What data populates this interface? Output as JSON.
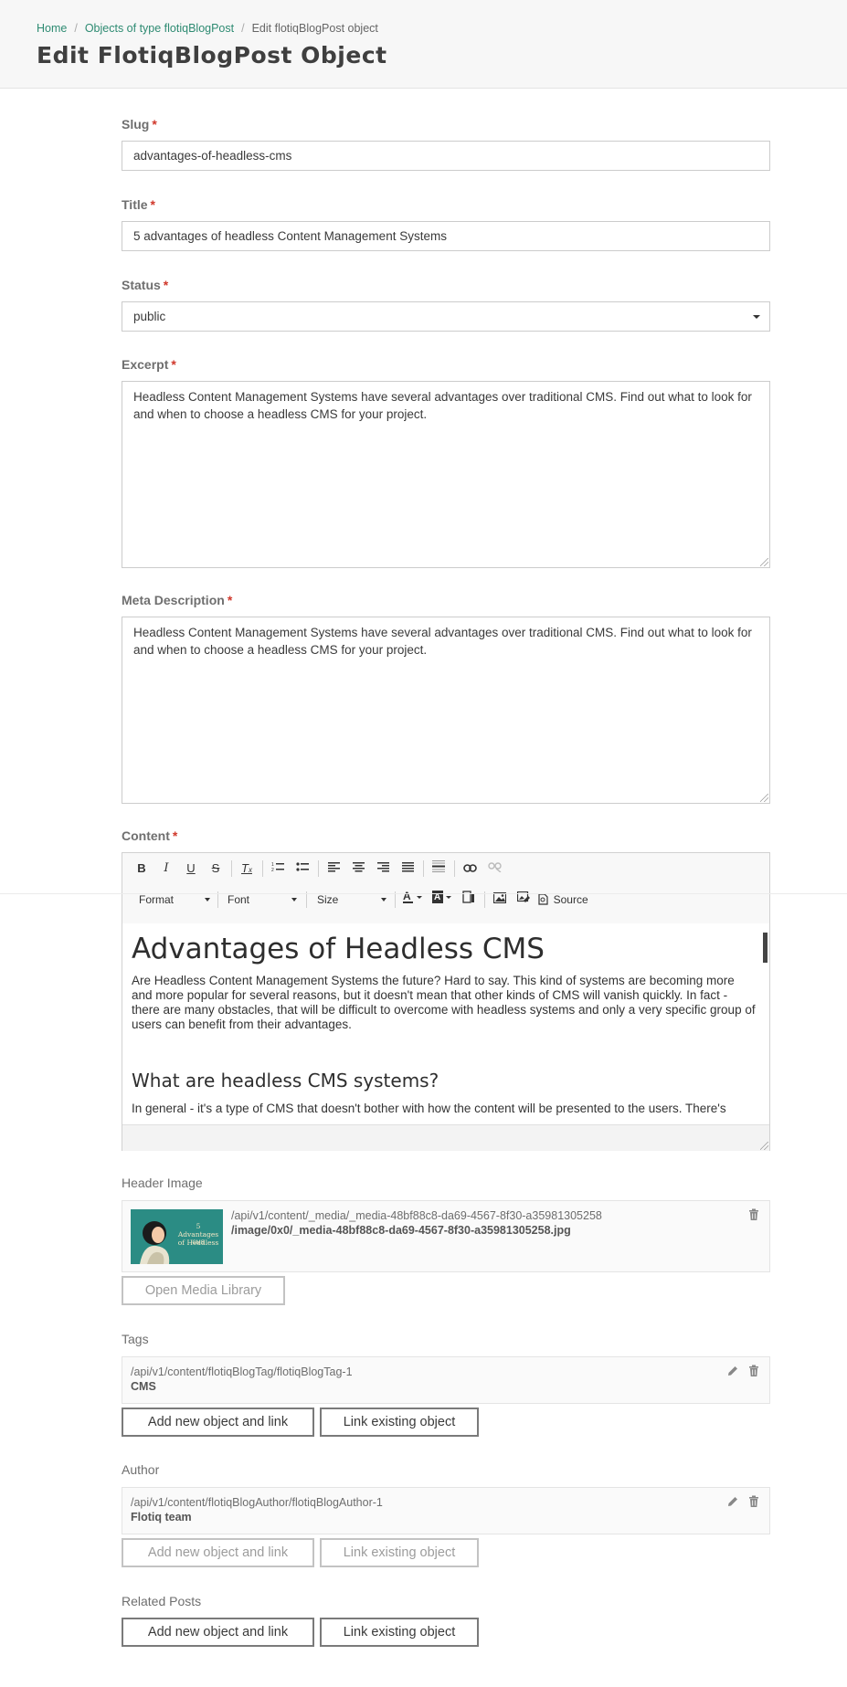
{
  "breadcrumb": {
    "home": "Home",
    "objects": "Objects of type flotiqBlogPost",
    "current": "Edit flotiqBlogPost object",
    "separator": "/"
  },
  "page_title": "Edit FlotiqBlogPost Object",
  "required_marker": "*",
  "fields": {
    "slug": {
      "label": "Slug",
      "value": "advantages-of-headless-cms"
    },
    "title": {
      "label": "Title",
      "value": "5 advantages of headless Content Management Systems"
    },
    "status": {
      "label": "Status",
      "value": "public"
    },
    "excerpt": {
      "label": "Excerpt",
      "value": "Headless Content Management Systems have several advantages over traditional CMS. Find out what to look for and when to choose a headless CMS for your project."
    },
    "meta_description": {
      "label": "Meta Description",
      "value": "Headless Content Management Systems have several advantages over traditional CMS. Find out what to look for and when to choose a headless CMS for your project."
    },
    "content": {
      "label": "Content",
      "toolbar": {
        "format": "Format",
        "font": "Font",
        "size": "Size",
        "source": "Source"
      },
      "heading": "Advantages of Headless CMS",
      "paragraph1": "Are Headless Content Management Systems the future? Hard to say. This kind of systems are becoming more and more popular for several reasons, but it doesn't mean that other kinds of CMS will vanish quickly. In fact - there are many obstacles, that will be difficult to overcome with headless systems and only a very specific group of users can benefit from their advantages.",
      "subheading": "What are headless CMS systems?",
      "paragraph2": "In general - it's a type of CMS that doesn't bother with how the content will be presented to the users. There's"
    }
  },
  "header_image": {
    "label": "Header Image",
    "path": "/api/v1/content/_media/_media-48bf88c8-da69-4567-8f30-a35981305258",
    "file": "/image/0x0/_media-48bf88c8-da69-4567-8f30-a35981305258.jpg",
    "thumb_title": "5 Advantages of Headless",
    "thumb_sub": "CMS",
    "open_media_library": "Open Media Library"
  },
  "tags": {
    "label": "Tags",
    "item_path": "/api/v1/content/flotiqBlogTag/flotiqBlogTag-1",
    "item_name": "CMS",
    "add_new": "Add new object and link",
    "link_existing": "Link existing object"
  },
  "author": {
    "label": "Author",
    "item_path": "/api/v1/content/flotiqBlogAuthor/flotiqBlogAuthor-1",
    "item_name": "Flotiq team",
    "add_new": "Add new object and link",
    "link_existing": "Link existing object"
  },
  "related_posts": {
    "label": "Related Posts",
    "add_new": "Add new object and link",
    "link_existing": "Link existing object"
  },
  "colors": {
    "accent": "#2e8b72",
    "required": "#d0382b",
    "thumb_bg": "#2b8c84"
  }
}
